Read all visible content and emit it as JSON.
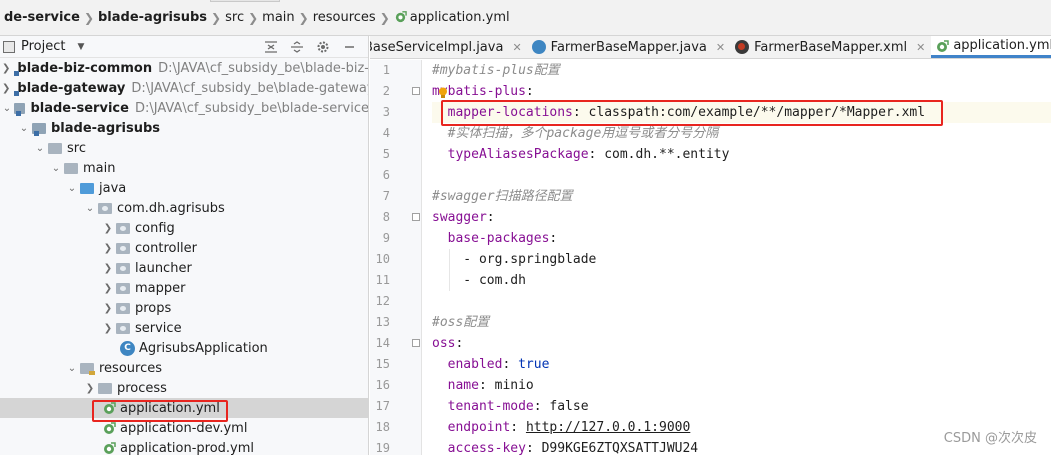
{
  "breadcrumb": {
    "items": [
      "de-service",
      "blade-agrisubs",
      "src",
      "main",
      "resources",
      "application.yml"
    ]
  },
  "project_panel": {
    "title": "Project",
    "tools": [
      "collapse-all-icon",
      "expand-all-icon",
      "gear-icon",
      "minimize-icon"
    ],
    "tree": [
      {
        "label": "blade-biz-common",
        "path": "D:\\JAVA\\cf_subsidy_be\\blade-biz-com"
      },
      {
        "label": "blade-gateway",
        "path": "D:\\JAVA\\cf_subsidy_be\\blade-gateway"
      },
      {
        "label": "blade-service",
        "path": "D:\\JAVA\\cf_subsidy_be\\blade-service"
      },
      {
        "label": "blade-agrisubs"
      },
      {
        "label": "src"
      },
      {
        "label": "main"
      },
      {
        "label": "java"
      },
      {
        "label": "com.dh.agrisubs"
      },
      {
        "label": "config"
      },
      {
        "label": "controller"
      },
      {
        "label": "launcher"
      },
      {
        "label": "mapper"
      },
      {
        "label": "props"
      },
      {
        "label": "service"
      },
      {
        "label": "AgrisubsApplication"
      },
      {
        "label": "resources"
      },
      {
        "label": "process"
      },
      {
        "label": "application.yml"
      },
      {
        "label": "application-dev.yml"
      },
      {
        "label": "application-prod.yml"
      }
    ]
  },
  "editor_tabs": [
    {
      "label": "BaseServiceImpl.java"
    },
    {
      "label": "FarmerBaseMapper.java"
    },
    {
      "label": "FarmerBaseMapper.xml"
    },
    {
      "label": "application.yml"
    }
  ],
  "code_lines": [
    {
      "n": "1",
      "parts": [
        {
          "t": "#mybatis-plus配置",
          "c": "comment"
        }
      ]
    },
    {
      "n": "2",
      "parts": [
        {
          "t": "mybatis-plus",
          "c": "key"
        },
        {
          "t": ":",
          "c": "plain"
        }
      ]
    },
    {
      "n": "3",
      "parts": [
        {
          "t": "  ",
          "c": "plain"
        },
        {
          "t": "mapper-locations",
          "c": "key"
        },
        {
          "t": ": classpath:com/example/**/mapper/*Mapper.xml",
          "c": "plain"
        }
      ]
    },
    {
      "n": "4",
      "parts": [
        {
          "t": "  #实体扫描，多个package用逗号或者分号分隔",
          "c": "comment"
        }
      ]
    },
    {
      "n": "5",
      "parts": [
        {
          "t": "  ",
          "c": "plain"
        },
        {
          "t": "typeAliasesPackage",
          "c": "key"
        },
        {
          "t": ": com.dh.**.entity",
          "c": "plain"
        }
      ]
    },
    {
      "n": "6",
      "parts": []
    },
    {
      "n": "7",
      "parts": [
        {
          "t": "#swagger扫描路径配置",
          "c": "comment"
        }
      ]
    },
    {
      "n": "8",
      "parts": [
        {
          "t": "swagger",
          "c": "key"
        },
        {
          "t": ":",
          "c": "plain"
        }
      ]
    },
    {
      "n": "9",
      "parts": [
        {
          "t": "  ",
          "c": "plain"
        },
        {
          "t": "base-packages",
          "c": "key"
        },
        {
          "t": ":",
          "c": "plain"
        }
      ]
    },
    {
      "n": "10",
      "parts": [
        {
          "t": "    - org.springblade",
          "c": "plain"
        }
      ]
    },
    {
      "n": "11",
      "parts": [
        {
          "t": "    - com.dh",
          "c": "plain"
        }
      ]
    },
    {
      "n": "12",
      "parts": []
    },
    {
      "n": "13",
      "parts": [
        {
          "t": "#oss配置",
          "c": "comment"
        }
      ]
    },
    {
      "n": "14",
      "parts": [
        {
          "t": "oss",
          "c": "key"
        },
        {
          "t": ":",
          "c": "plain"
        }
      ]
    },
    {
      "n": "15",
      "parts": [
        {
          "t": "  ",
          "c": "plain"
        },
        {
          "t": "enabled",
          "c": "key"
        },
        {
          "t": ": ",
          "c": "plain"
        },
        {
          "t": "true",
          "c": "key2"
        }
      ]
    },
    {
      "n": "16",
      "parts": [
        {
          "t": "  ",
          "c": "plain"
        },
        {
          "t": "name",
          "c": "key"
        },
        {
          "t": ": minio",
          "c": "plain"
        }
      ]
    },
    {
      "n": "17",
      "parts": [
        {
          "t": "  ",
          "c": "plain"
        },
        {
          "t": "tenant-mode",
          "c": "key"
        },
        {
          "t": ": false",
          "c": "plain"
        }
      ]
    },
    {
      "n": "18",
      "parts": [
        {
          "t": "  ",
          "c": "plain"
        },
        {
          "t": "endpoint",
          "c": "key"
        },
        {
          "t": ": ",
          "c": "plain"
        },
        {
          "t": "http://127.0.0.1:9000",
          "c": "link"
        }
      ]
    },
    {
      "n": "19",
      "parts": [
        {
          "t": "  ",
          "c": "plain"
        },
        {
          "t": "access-key",
          "c": "key"
        },
        {
          "t": ": D99KGE6ZTQXSATTJWU24",
          "c": "plain"
        }
      ]
    }
  ],
  "watermark": "CSDN @次次皮",
  "colors": {
    "highlight": "#e8251f",
    "active_tab_underline": "#4083c9",
    "yaml_key": "#871094",
    "comment": "#8c8c8c"
  }
}
